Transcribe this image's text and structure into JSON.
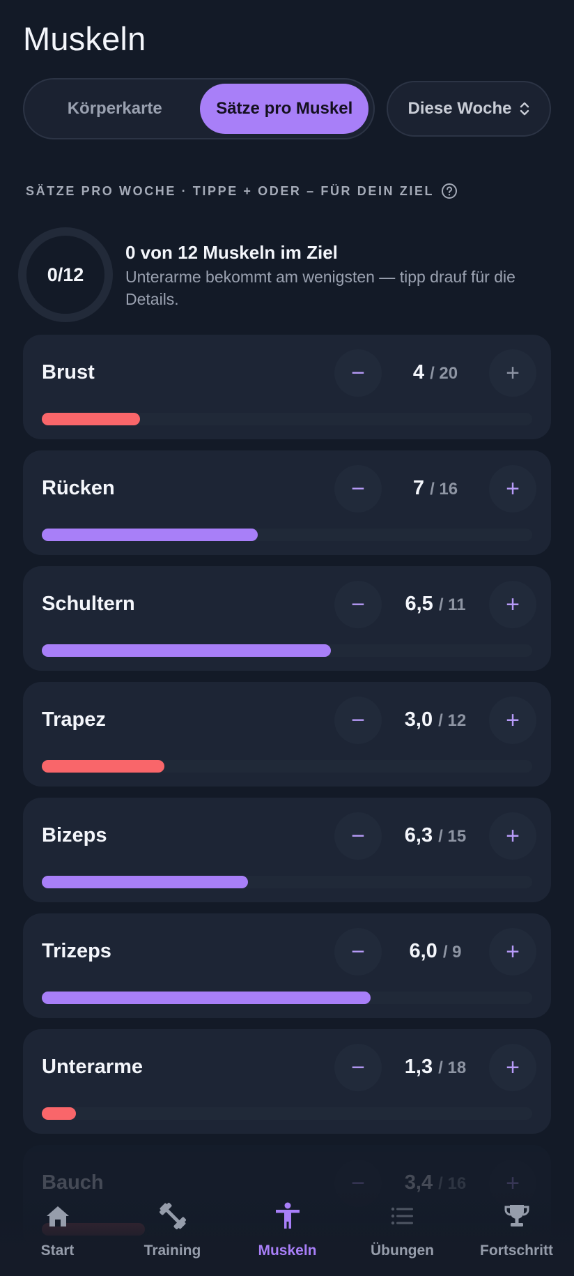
{
  "page": {
    "title": "Muskeln"
  },
  "segment": {
    "options": [
      "Körperkarte",
      "Sätze pro Muskel"
    ],
    "selected": 1
  },
  "range_select": {
    "label": "Diese Woche"
  },
  "section": {
    "label": "SÄTZE PRO WOCHE · TIPPE + ODER – FÜR DEIN ZIEL"
  },
  "summary": {
    "ring_label": "0/12",
    "title": "0 von 12 Muskeln im Ziel",
    "subtitle": "Unterarme bekommt am wenigsten — tipp drauf für die Details."
  },
  "controls": {
    "minus": "−",
    "plus": "+"
  },
  "colors": {
    "accent": "#a87ff8",
    "low": "#f9666a",
    "track": "#202938",
    "card": "#1d2535",
    "background": "#131a27"
  },
  "muscles": [
    {
      "name": "Brust",
      "value": "4",
      "target": "/ 20",
      "progress": 0.2,
      "status": "low"
    },
    {
      "name": "Rücken",
      "value": "7",
      "target": "/ 16",
      "progress": 0.44,
      "status": "ok"
    },
    {
      "name": "Schultern",
      "value": "6,5",
      "target": "/ 11",
      "progress": 0.59,
      "status": "ok"
    },
    {
      "name": "Trapez",
      "value": "3,0",
      "target": "/ 12",
      "progress": 0.25,
      "status": "low"
    },
    {
      "name": "Bizeps",
      "value": "6,3",
      "target": "/ 15",
      "progress": 0.42,
      "status": "ok"
    },
    {
      "name": "Trizeps",
      "value": "6,0",
      "target": "/ 9",
      "progress": 0.67,
      "status": "ok"
    },
    {
      "name": "Unterarme",
      "value": "1,3",
      "target": "/ 18",
      "progress": 0.07,
      "status": "low"
    },
    {
      "name": "Bauch",
      "value": "3,4",
      "target": "/ 16",
      "progress": 0.21,
      "status": "low"
    }
  ],
  "nav": {
    "items": [
      {
        "label": "Start",
        "icon": "home-icon"
      },
      {
        "label": "Training",
        "icon": "dumbbell-icon"
      },
      {
        "label": "Muskeln",
        "icon": "person-icon"
      },
      {
        "label": "Übungen",
        "icon": "list-icon"
      },
      {
        "label": "Fortschritt",
        "icon": "trophy-icon"
      }
    ],
    "active": 2
  }
}
